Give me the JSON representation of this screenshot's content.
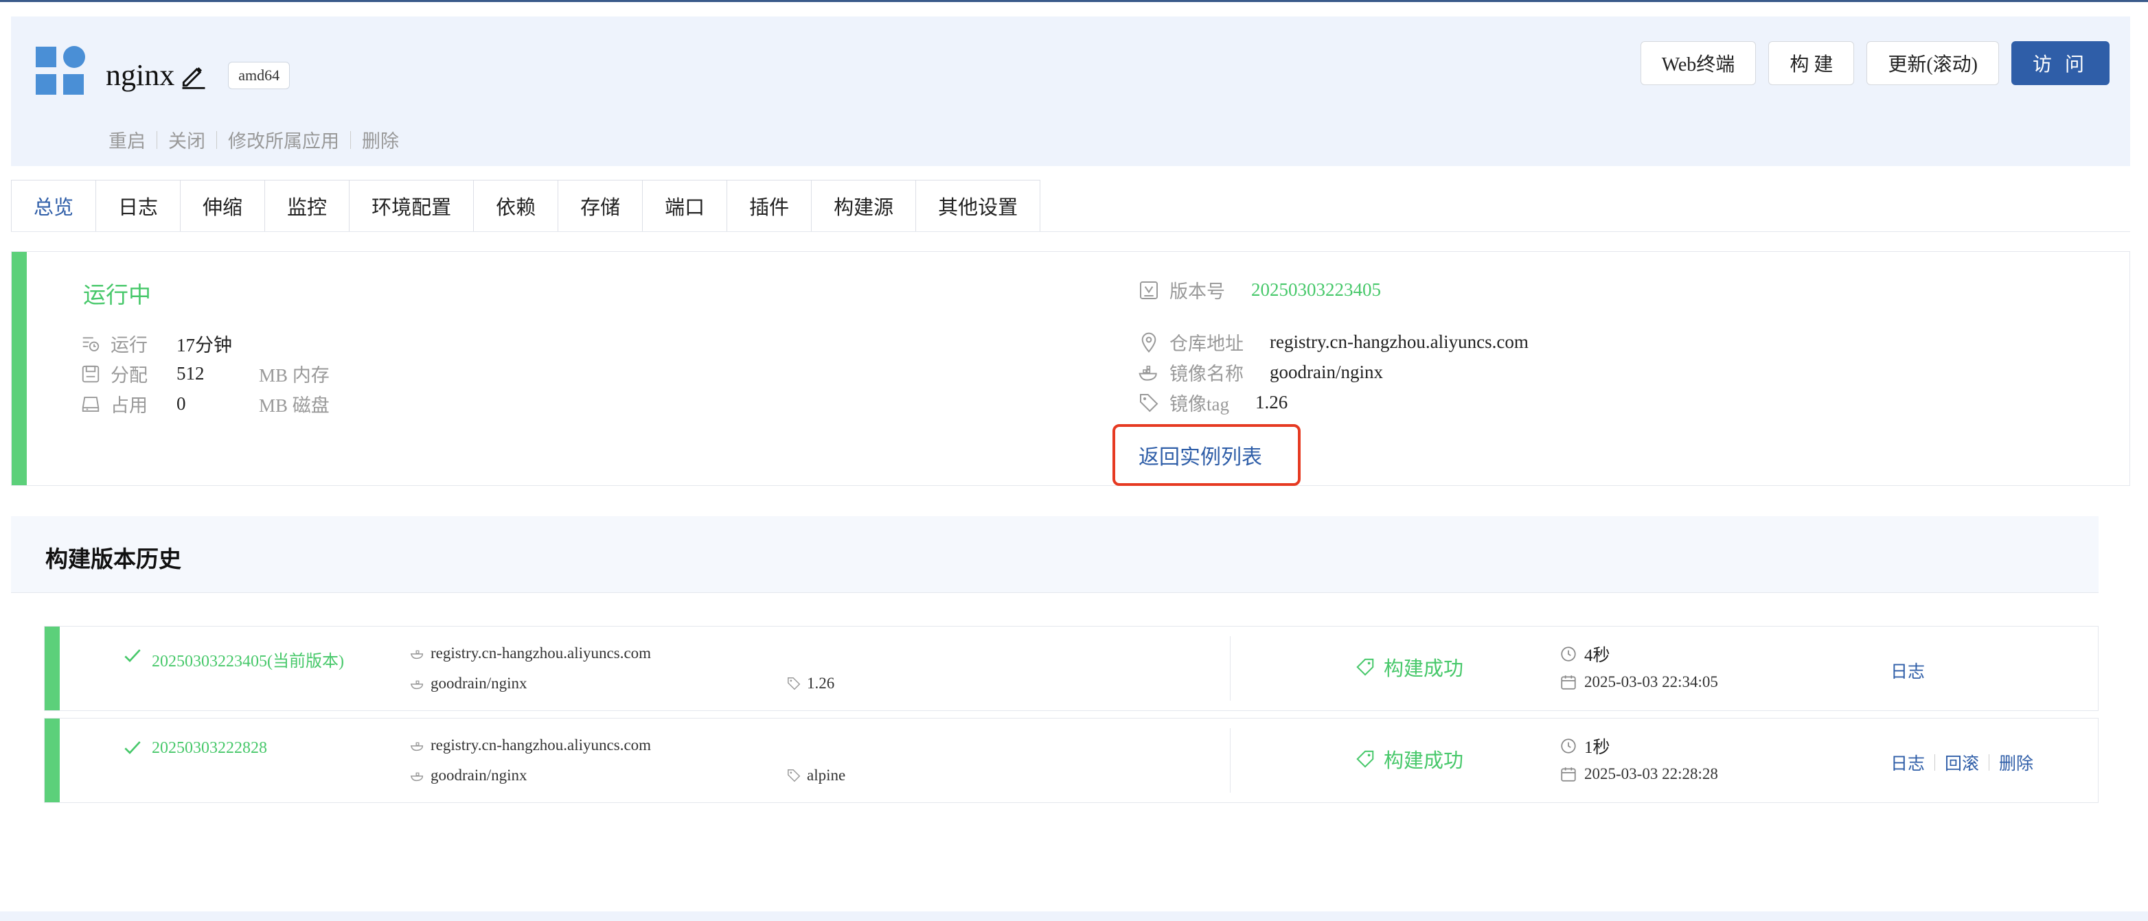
{
  "header": {
    "app_name": "nginx",
    "arch": "amd64",
    "links": [
      "重启",
      "关闭",
      "修改所属应用",
      "删除"
    ],
    "buttons": {
      "web_terminal": "Web终端",
      "build": "构 建",
      "update": "更新(滚动)",
      "visit": "访 问"
    }
  },
  "tabs": [
    "总览",
    "日志",
    "伸缩",
    "监控",
    "环境配置",
    "依赖",
    "存储",
    "端口",
    "插件",
    "构建源",
    "其他设置"
  ],
  "status": {
    "state": "运行中",
    "run_label": "运行",
    "run_value": "17分钟",
    "alloc_label": "分配",
    "alloc_value": "512",
    "alloc_unit": "MB 内存",
    "used_label": "占用",
    "used_value": "0",
    "used_unit": "MB 磁盘"
  },
  "info": {
    "version_label": "版本号",
    "version_value": "20250303223405",
    "repo_label": "仓库地址",
    "repo_value": "registry.cn-hangzhou.aliyuncs.com",
    "image_label": "镜像名称",
    "image_value": "goodrain/nginx",
    "tag_label": "镜像tag",
    "tag_value": "1.26",
    "back_link": "返回实例列表"
  },
  "history": {
    "title": "构建版本历史",
    "rows": [
      {
        "version": "20250303223405(当前版本)",
        "registry": "registry.cn-hangzhou.aliyuncs.com",
        "image": "goodrain/nginx",
        "tag": "1.26",
        "status": "构建成功",
        "duration": "4秒",
        "date": "2025-03-03 22:34:05",
        "actions": [
          "日志"
        ]
      },
      {
        "version": "20250303222828",
        "registry": "registry.cn-hangzhou.aliyuncs.com",
        "image": "goodrain/nginx",
        "tag": "alpine",
        "status": "构建成功",
        "duration": "1秒",
        "date": "2025-03-03 22:28:28",
        "actions": [
          "日志",
          "回滚",
          "删除"
        ]
      }
    ]
  },
  "colors": {
    "accent_blue": "#2f5ea8",
    "success_green": "#47c86a",
    "highlight_red": "#e63a22",
    "header_bg": "#eef3fc"
  }
}
